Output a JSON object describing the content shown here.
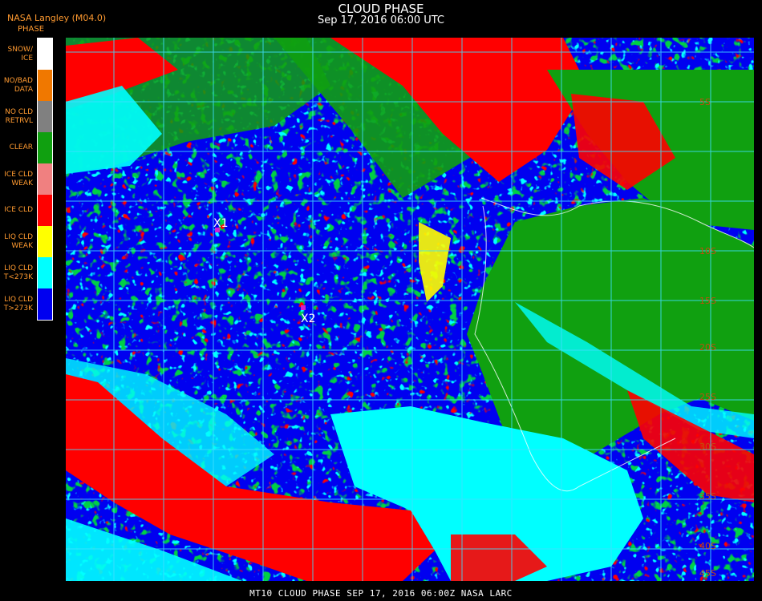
{
  "header": {
    "org": "NASA Langley (M04.0)",
    "title": "CLOUD PHASE",
    "subtitle": "Sep 17, 2016 06:00 UTC"
  },
  "legend": {
    "title": "PHASE",
    "items": [
      {
        "label": "SNOW/ ICE",
        "color": "#ffffff"
      },
      {
        "label": "NO/BAD DATA",
        "color": "#f07800"
      },
      {
        "label": "NO CLD RETRVL",
        "color": "#808080"
      },
      {
        "label": "CLEAR",
        "color": "#10a010"
      },
      {
        "label": "ICE CLD WEAK",
        "color": "#f08080"
      },
      {
        "label": "ICE CLD",
        "color": "#ff0000"
      },
      {
        "label": "LIQ CLD WEAK",
        "color": "#ffff00"
      },
      {
        "label": "LIQ CLD T<273K",
        "color": "#00ffff"
      },
      {
        "label": "LIQ CLD T>273K",
        "color": "#0000f0"
      }
    ]
  },
  "markers": [
    {
      "label": "X1"
    },
    {
      "label": "X2"
    }
  ],
  "grid_labels": [
    "5S",
    "10S",
    "15S",
    "20S",
    "25S",
    "30S",
    "35S",
    "40S",
    "45S"
  ],
  "footer": "MT10  CLOUD PHASE  SEP 17, 2016 06:00Z  NASA LARC",
  "colors": {
    "ocean_liq_warm": "#0000f0",
    "liq_cold": "#00ffff",
    "clear": "#10a010",
    "ice": "#ff0000",
    "grid": "#40e0ff",
    "marker": "#d020d0"
  }
}
